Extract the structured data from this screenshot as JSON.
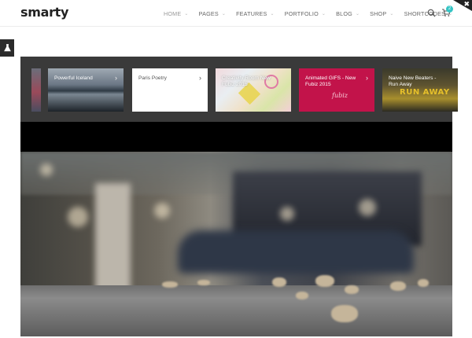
{
  "brand": {
    "logo": "smarty"
  },
  "nav": {
    "items": [
      {
        "label": "HOME"
      },
      {
        "label": "PAGES"
      },
      {
        "label": "FEATURES"
      },
      {
        "label": "PORTFOLIO"
      },
      {
        "label": "BLOG"
      },
      {
        "label": "SHOP"
      },
      {
        "label": "SHORTCODES"
      }
    ],
    "cart_count": "2"
  },
  "slider": {
    "items": [
      {
        "title": "Powerful Iceland"
      },
      {
        "title": "Paris Poetry"
      },
      {
        "title": "Creativity Room New Fubiz 2015"
      },
      {
        "title": "Animated GIFS - New Fubiz 2015"
      },
      {
        "title": "Naive New Beaters - Run Away"
      }
    ],
    "poster_text": "RUN AWAY",
    "gif_script": "fubiz"
  },
  "icons": {
    "search": "search-icon",
    "cart": "cart-icon",
    "close": "close-icon",
    "flask": "flask-icon",
    "chevron": "chevron-right-icon"
  },
  "colors": {
    "accent": "#35c5c5",
    "header_bg": "#ffffff",
    "slider_bg": "#3a3a3a",
    "gif_thumb": "#c2134a"
  }
}
